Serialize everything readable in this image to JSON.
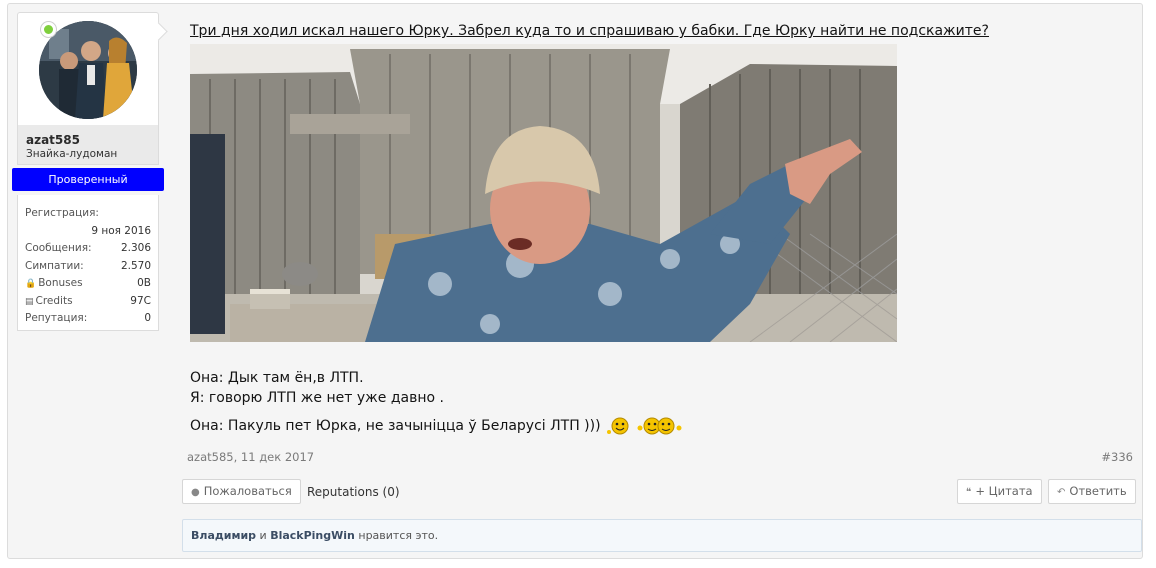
{
  "user": {
    "username": "azat585",
    "title": "Знайка-лудоман",
    "badge": "Проверенный",
    "online_color": "#7fcf3d",
    "badge_color": "#0000ff",
    "stats": {
      "registration_label": "Регистрация:",
      "registration_value": "9 ноя 2016",
      "messages_label": "Сообщения:",
      "messages_value": "2.306",
      "likes_label": "Симпатии:",
      "likes_value": "2.570",
      "bonuses_label": "Bonuses",
      "bonuses_value": "0B",
      "credits_label": "Credits",
      "credits_value": "97C",
      "reputation_label": "Репутация:",
      "reputation_value": "0"
    }
  },
  "post": {
    "title_line": "Три дня ходил искал нашего Юрку. Забрел куда то и спрашиваю у бабки. Где Юрку найти не подскажите?",
    "line1": "Она: Дык там ён,в ЛТП.",
    "line2": "Я: говорю ЛТП же нет уже давно .",
    "line3": "Она: Пакуль пет Юрка, не зачыніцца ў Беларусі ЛТП )))",
    "author_date": "azat585, 11 дек 2017",
    "post_number": "#336"
  },
  "actions": {
    "report": "Пожаловаться",
    "reputations": "Reputations (0)",
    "quote": "+ Цитата",
    "reply": "Ответить"
  },
  "likes": {
    "user1": "Владимир",
    "conjunction": "и",
    "user2": "BlackPingWin",
    "suffix": "нравится это."
  }
}
